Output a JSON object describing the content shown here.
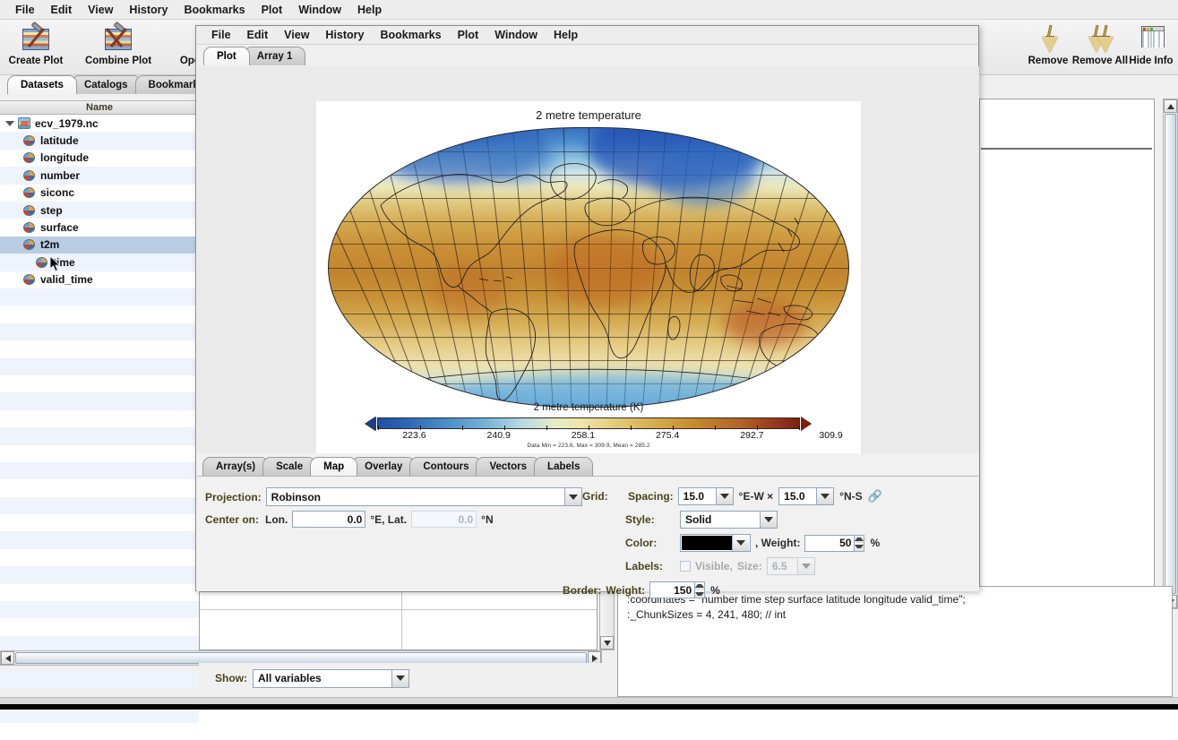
{
  "app": {
    "menus": [
      "File",
      "Edit",
      "View",
      "History",
      "Bookmarks",
      "Plot",
      "Window",
      "Help"
    ]
  },
  "toolbar": {
    "items": [
      {
        "label": "Create Plot",
        "icon": "create-plot-icon"
      },
      {
        "label": "Combine Plot",
        "icon": "combine-plot-icon"
      },
      {
        "label": "Ope",
        "icon": "open-icon"
      }
    ],
    "right_items": [
      {
        "label": "Remove",
        "icon": "broom-icon"
      },
      {
        "label": "Remove All",
        "icon": "broom-all-icon"
      },
      {
        "label": "Hide Info",
        "icon": "window-info-icon"
      }
    ]
  },
  "left_panel": {
    "tabs": [
      {
        "label": "Datasets",
        "selected": true
      },
      {
        "label": "Catalogs",
        "selected": false
      },
      {
        "label": "Bookmark",
        "selected": false
      }
    ],
    "column_header": "Name",
    "tree": [
      {
        "label": "ecv_1979.nc",
        "type": "dataset",
        "depth": 0,
        "expanded": true,
        "selected": false
      },
      {
        "label": "latitude",
        "type": "variable",
        "depth": 1,
        "selected": false
      },
      {
        "label": "longitude",
        "type": "variable",
        "depth": 1,
        "selected": false
      },
      {
        "label": "number",
        "type": "variable",
        "depth": 1,
        "selected": false
      },
      {
        "label": "siconc",
        "type": "variable",
        "depth": 1,
        "selected": false
      },
      {
        "label": "step",
        "type": "variable",
        "depth": 1,
        "selected": false
      },
      {
        "label": "surface",
        "type": "variable",
        "depth": 1,
        "selected": false
      },
      {
        "label": "t2m",
        "type": "variable",
        "depth": 1,
        "selected": true
      },
      {
        "label": "time",
        "type": "variable",
        "depth": 1,
        "selected": false
      },
      {
        "label": "valid_time",
        "type": "variable",
        "depth": 1,
        "selected": false
      }
    ]
  },
  "show_bar": {
    "label": "Show:",
    "value": "All variables"
  },
  "info_panel": {
    "lines": [
      ":coordinates = \"number time step surface latitude longitude valid_time\";",
      ":_ChunkSizes = 4, 241, 480; // int"
    ]
  },
  "plot_window": {
    "menus": [
      "File",
      "Edit",
      "View",
      "History",
      "Bookmarks",
      "Plot",
      "Window",
      "Help"
    ],
    "tabs": [
      {
        "label": "Plot",
        "selected": true
      },
      {
        "label": "Array 1",
        "selected": false
      }
    ]
  },
  "chart_data": {
    "type": "heatmap",
    "title": "2 metre temperature",
    "colorbar_title": "2 metre temperature (K)",
    "projection": "Robinson",
    "units": "K",
    "colormap": "blue-to-dark-red (panoply CB_RdYlBu reversed)",
    "tick_labels": [
      "223.6",
      "240.9",
      "258.1",
      "275.4",
      "292.7",
      "309.9"
    ],
    "tick_values": [
      223.6,
      240.9,
      258.1,
      275.4,
      292.7,
      309.9
    ],
    "vmin": 223.6,
    "vmax": 309.9,
    "stats_text": "Data Min = 223.6, Max = 309.9, Mean = 285.2",
    "data_min": 223.6,
    "data_max": 309.9,
    "data_mean": 285.2,
    "grid_spacing_deg": 15.0,
    "center_lon": 0.0,
    "center_lat": 0.0,
    "out_of_range_low_arrow": true,
    "out_of_range_high_arrow": true
  },
  "settings": {
    "tabs": [
      {
        "label": "Array(s)",
        "selected": false
      },
      {
        "label": "Scale",
        "selected": false
      },
      {
        "label": "Map",
        "selected": true
      },
      {
        "label": "Overlay",
        "selected": false
      },
      {
        "label": "Contours",
        "selected": false
      },
      {
        "label": "Vectors",
        "selected": false
      },
      {
        "label": "Labels",
        "selected": false
      }
    ],
    "map": {
      "projection_label": "Projection:",
      "projection_value": "Robinson",
      "center_on_label": "Center on:",
      "lon_label": "Lon.",
      "lon_value": "0.0",
      "lon_unit": "°E, Lat.",
      "lat_value": "0.0",
      "lat_unit": "°N"
    },
    "grid": {
      "grid_label": "Grid:",
      "spacing_label": "Spacing:",
      "spacing_ew": "15.0",
      "ew_unit": "°E-W ×",
      "spacing_ns": "15.0",
      "ns_unit": "°N-S",
      "link_icon": "link-icon",
      "style_label": "Style:",
      "style_value": "Solid",
      "color_label": "Color:",
      "color_value": "#000000",
      "weight_label": ", Weight:",
      "weight_value": "50",
      "weight_unit": "%",
      "labels_label": "Labels:",
      "visible_label": "Visible,",
      "visible_checked": false,
      "size_label": "Size:",
      "size_value": "6.5",
      "border_label": "Border:",
      "border_weight_label": "Weight:",
      "border_weight_value": "150",
      "border_weight_unit": "%"
    }
  }
}
